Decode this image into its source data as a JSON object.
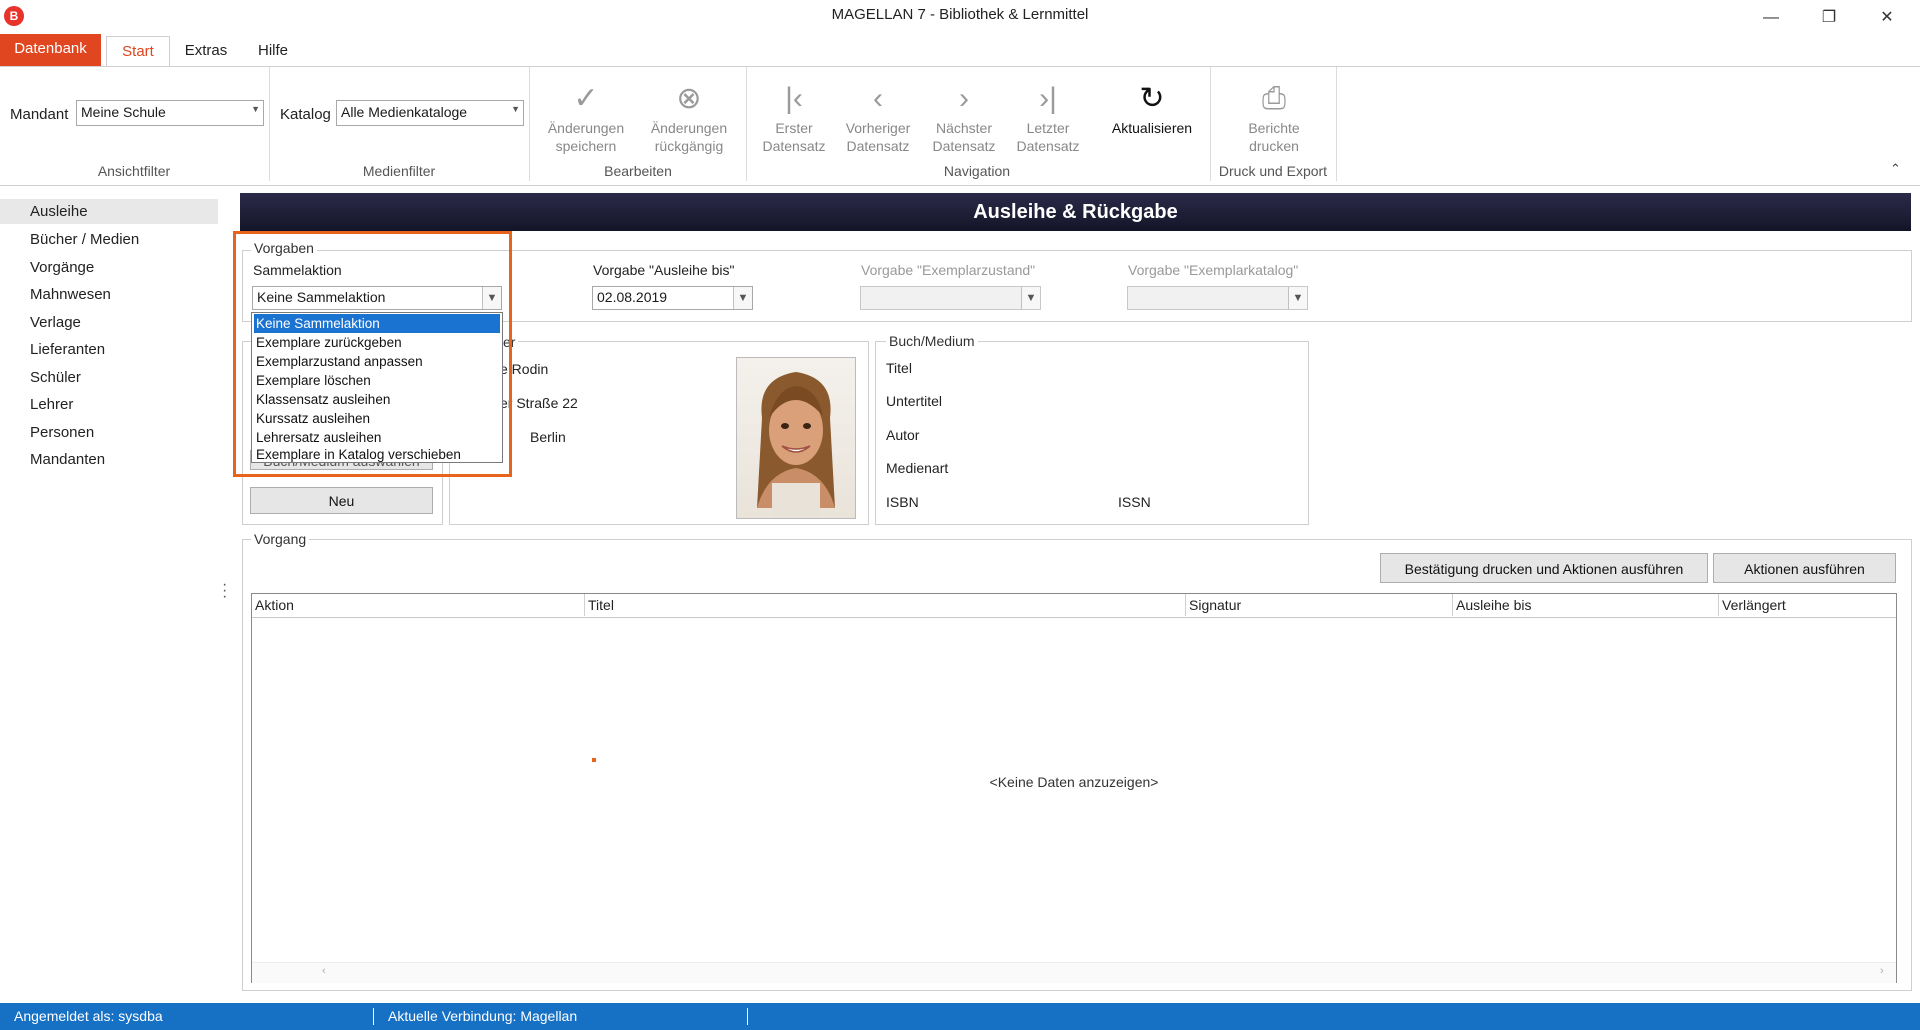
{
  "window": {
    "app_icon": "B",
    "title": "MAGELLAN 7 - Bibliothek & Lernmittel",
    "minimize": "—",
    "restore": "❐",
    "close": "✕"
  },
  "ribbon_tabs": [
    "Datenbank",
    "Start",
    "Extras",
    "Hilfe"
  ],
  "ribbon": {
    "mandant_label": "Mandant",
    "mandant_value": "Meine Schule",
    "katalog_label": "Katalog",
    "katalog_value": "Alle Medienkataloge",
    "group_ansichtfilter": "Ansichtfilter",
    "group_medienfilter": "Medienfilter",
    "group_bearbeiten": "Bearbeiten",
    "group_navigation": "Navigation",
    "group_druck": "Druck und Export",
    "btn_save_1": "Änderungen",
    "btn_save_2": "speichern",
    "btn_undo_1": "Änderungen",
    "btn_undo_2": "rückgängig",
    "btn_first_1": "Erster",
    "btn_first_2": "Datensatz",
    "btn_prev_1": "Vorheriger",
    "btn_prev_2": "Datensatz",
    "btn_next_1": "Nächster",
    "btn_next_2": "Datensatz",
    "btn_last_1": "Letzter",
    "btn_last_2": "Datensatz",
    "btn_refresh": "Aktualisieren",
    "btn_print_1": "Berichte",
    "btn_print_2": "drucken",
    "icons": {
      "save": "check-circle-icon",
      "undo": "x-circle-icon",
      "first": "first-record-icon",
      "prev": "prev-record-icon",
      "next": "next-record-icon",
      "last": "last-record-icon",
      "refresh": "refresh-icon",
      "print": "printer-icon",
      "collapse": "chevron-up-icon"
    }
  },
  "nav": [
    "Ausleihe",
    "Bücher / Medien",
    "Vorgänge",
    "Mahnwesen",
    "Verlage",
    "Lieferanten",
    "Schüler",
    "Lehrer",
    "Personen",
    "Mandanten"
  ],
  "main": {
    "header": "Ausleihe & Rückgabe",
    "vorgaben_title": "Vorgaben",
    "sammelaktion_label": "Sammelaktion",
    "sammelaktion_value": "Keine Sammelaktion",
    "ausleihe_bis_label": "Vorgabe \"Ausleihe bis\"",
    "ausleihe_bis_value": "02.08.2019",
    "zustand_label": "Vorgabe \"Exemplarzustand\"",
    "katalog_label": "Vorgabe \"Exemplarkatalog\"",
    "dropdown_options": [
      "Keine Sammelaktion",
      "Exemplare zurückgeben",
      "Exemplarzustand anpassen",
      "Exemplare löschen",
      "Klassensatz ausleihen",
      "Kurssatz ausleihen",
      "Lehrersatz ausleihen",
      "Exemplare in Katalog verschieben"
    ],
    "person_title_fragment": "er",
    "person_name_fragment": "e Rodin",
    "person_street_fragment": "er Straße 22",
    "person_city": "Berlin",
    "hidden_button_fragment": "Buch/Medium auswählen",
    "neu_button": "Neu",
    "buch_title": "Buch/Medium",
    "buch_titel": "Titel",
    "buch_untertitel": "Untertitel",
    "buch_autor": "Autor",
    "buch_medienart": "Medienart",
    "buch_isbn": "ISBN",
    "buch_issn": "ISSN",
    "vorgang_title": "Vorgang",
    "btn_confirm_print": "Bestätigung drucken und Aktionen ausführen",
    "btn_execute": "Aktionen ausführen",
    "columns": [
      "Aktion",
      "Titel",
      "Signatur",
      "Ausleihe bis",
      "Verlängert"
    ],
    "empty_text": "<Keine Daten anzuzeigen>"
  },
  "statusbar": {
    "user": "Angemeldet als: sysdba",
    "connection": "Aktuelle Verbindung: Magellan"
  },
  "colors": {
    "accent": "#e0461f",
    "statusbar": "#1670c4",
    "header_bar": "#1e1e38",
    "highlight_box": "#e8641c"
  }
}
